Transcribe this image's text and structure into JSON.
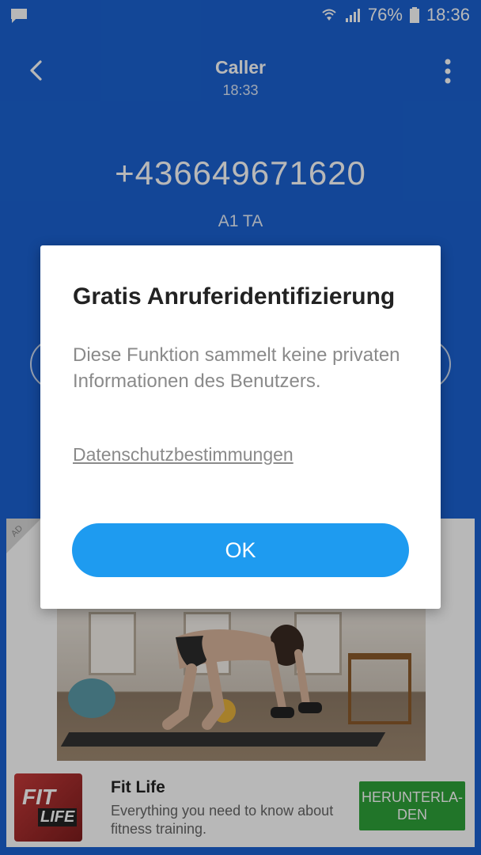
{
  "status_bar": {
    "battery": "76%",
    "time": "18:36"
  },
  "header": {
    "title": "Caller",
    "subtitle": "18:33"
  },
  "caller": {
    "number": "+436649671620",
    "carrier": "A1 TA"
  },
  "ad": {
    "badge": "AD",
    "app_name": "Fit Life",
    "app_description": "Everything you need to know about fitness training.",
    "install_label_line1": "HERUNTERLA-",
    "install_label_line2": "DEN",
    "logo_text_top": "FIT",
    "logo_text_bottom": "LIFE"
  },
  "dialog": {
    "title": "Gratis Anruferidentifizierung",
    "body": "Diese Funktion sammelt keine privaten Informationen des Benutzers.",
    "link": "Datenschutzbestimmungen",
    "ok_label": "OK"
  },
  "colors": {
    "background": "#1b62d1",
    "ok_button": "#1e9bf0",
    "install_button": "#2fa23a"
  },
  "icons": [
    "message-icon",
    "wifi-icon",
    "signal-icon",
    "battery-icon",
    "back-icon",
    "more-icon"
  ]
}
